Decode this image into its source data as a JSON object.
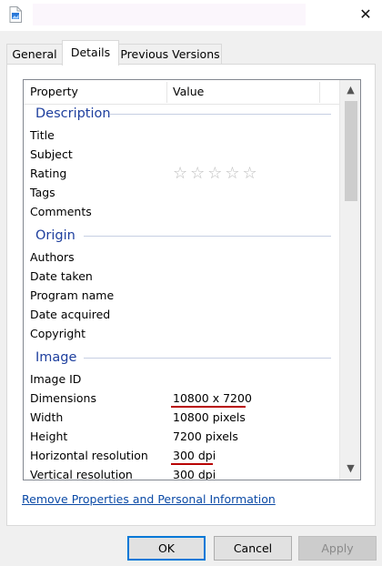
{
  "window": {
    "close_glyph": "✕",
    "file_icon": "document-image-icon"
  },
  "tabs": [
    {
      "label": "General",
      "active": false
    },
    {
      "label": "Details",
      "active": true
    },
    {
      "label": "Previous Versions",
      "active": false
    }
  ],
  "list": {
    "headers": {
      "property": "Property",
      "value": "Value"
    },
    "groups": {
      "description": "Description",
      "origin": "Origin",
      "image": "Image"
    },
    "description_rows": [
      {
        "property": "Title",
        "value": ""
      },
      {
        "property": "Subject",
        "value": ""
      },
      {
        "property": "Rating",
        "value": ""
      },
      {
        "property": "Tags",
        "value": ""
      },
      {
        "property": "Comments",
        "value": ""
      }
    ],
    "rating_stars": "☆☆☆☆☆",
    "rating_value": 0,
    "origin_rows": [
      {
        "property": "Authors",
        "value": ""
      },
      {
        "property": "Date taken",
        "value": ""
      },
      {
        "property": "Program name",
        "value": ""
      },
      {
        "property": "Date acquired",
        "value": ""
      },
      {
        "property": "Copyright",
        "value": ""
      }
    ],
    "image_rows": [
      {
        "property": "Image ID",
        "value": ""
      },
      {
        "property": "Dimensions",
        "value": "10800 x 7200"
      },
      {
        "property": "Width",
        "value": "10800 pixels"
      },
      {
        "property": "Height",
        "value": "7200 pixels"
      },
      {
        "property": "Horizontal resolution",
        "value": "300 dpi"
      },
      {
        "property": "Vertical resolution",
        "value": "300 dpi"
      }
    ],
    "scroll_up_glyph": "▲",
    "scroll_down_glyph": "▼"
  },
  "link_text": "Remove Properties and Personal Information",
  "buttons": {
    "ok": "OK",
    "cancel": "Cancel",
    "apply": "Apply"
  },
  "colors": {
    "group_heading": "#1e3f9e",
    "link": "#0b4aa6",
    "annotation_underline": "#b80000",
    "ok_focus_border": "#0078d7"
  }
}
